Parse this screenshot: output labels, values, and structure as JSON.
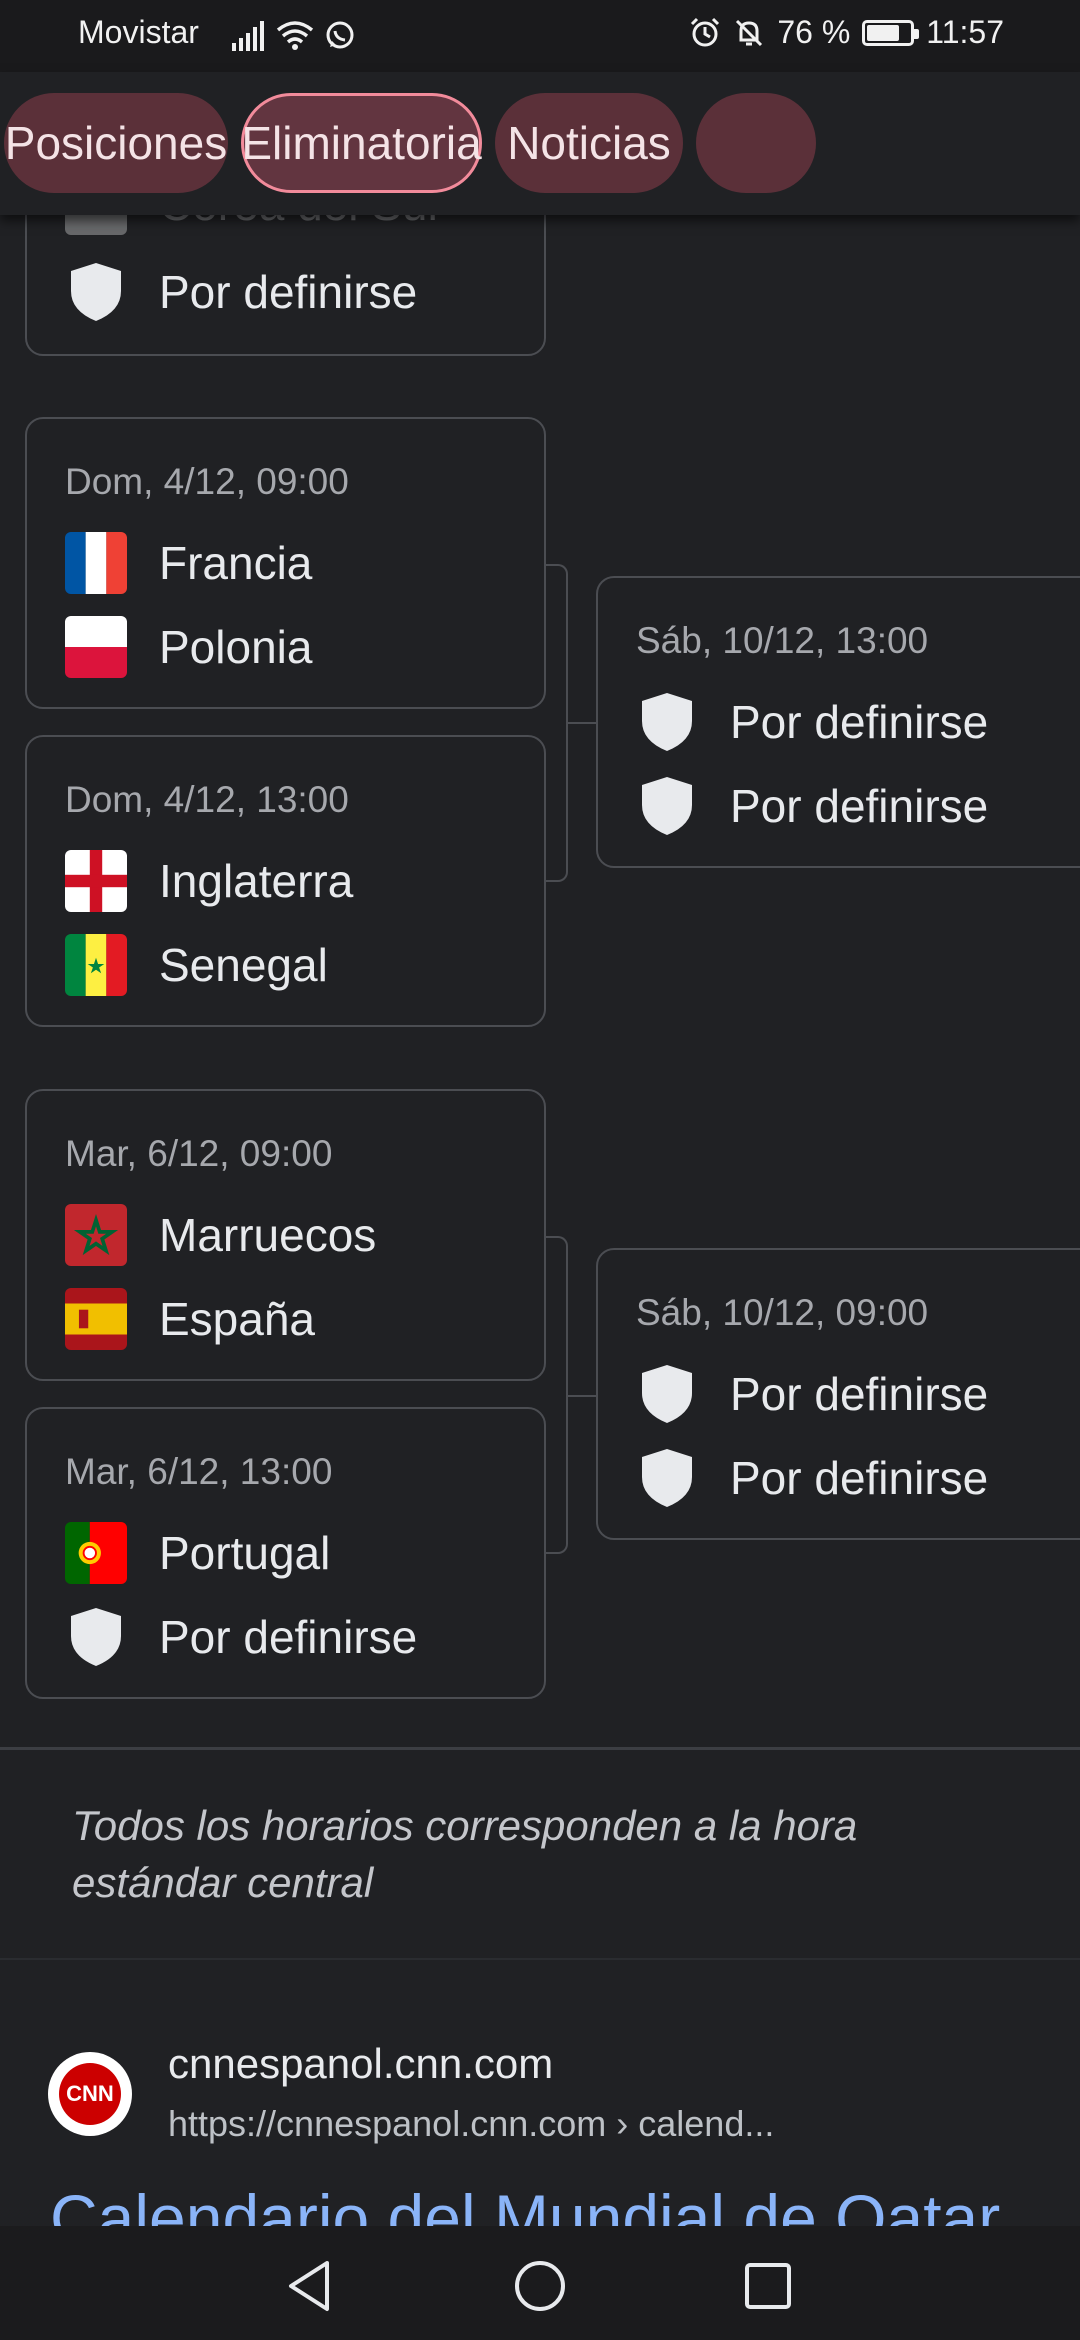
{
  "status_bar": {
    "carrier": "Movistar",
    "battery_percent": "76 %",
    "battery_level": 0.76,
    "time": "11:57"
  },
  "tabs": [
    {
      "label": "Posiciones"
    },
    {
      "label": "Eliminatoria",
      "active": true
    },
    {
      "label": "Noticias"
    }
  ],
  "bracket": {
    "top_partial": {
      "team_cut": "Corea del Sur",
      "team_tbd": "Por definirse"
    },
    "matches": [
      {
        "date": "Dom, 4/12, 09:00",
        "home": "Francia",
        "away": "Polonia"
      },
      {
        "date": "Dom, 4/12, 13:00",
        "home": "Inglaterra",
        "away": "Senegal"
      },
      {
        "date": "Mar, 6/12, 09:00",
        "home": "Marruecos",
        "away": "España"
      },
      {
        "date": "Mar, 6/12, 13:00",
        "home": "Portugal",
        "away": "Por definirse"
      }
    ],
    "quarterfinals": [
      {
        "date": "Sáb, 10/12, 13:00",
        "home": "Por definirse",
        "away": "Por definirse"
      },
      {
        "date": "Sáb, 10/12, 09:00",
        "home": "Por definirse",
        "away": "Por definirse"
      }
    ]
  },
  "footnote": "Todos los horarios corresponden a la hora estándar central",
  "search_result": {
    "logo_text": "CNN",
    "site_name": "cnnespanol.cnn.com",
    "url": "https://cnnespanol.cnn.com › calend...",
    "title": "Calendario del Mundial de Qatar"
  },
  "colors": {
    "background": "#202124",
    "chip_bg": "#5b3039",
    "chip_active_border": "#f28b9b",
    "link": "#8ab4f8"
  }
}
